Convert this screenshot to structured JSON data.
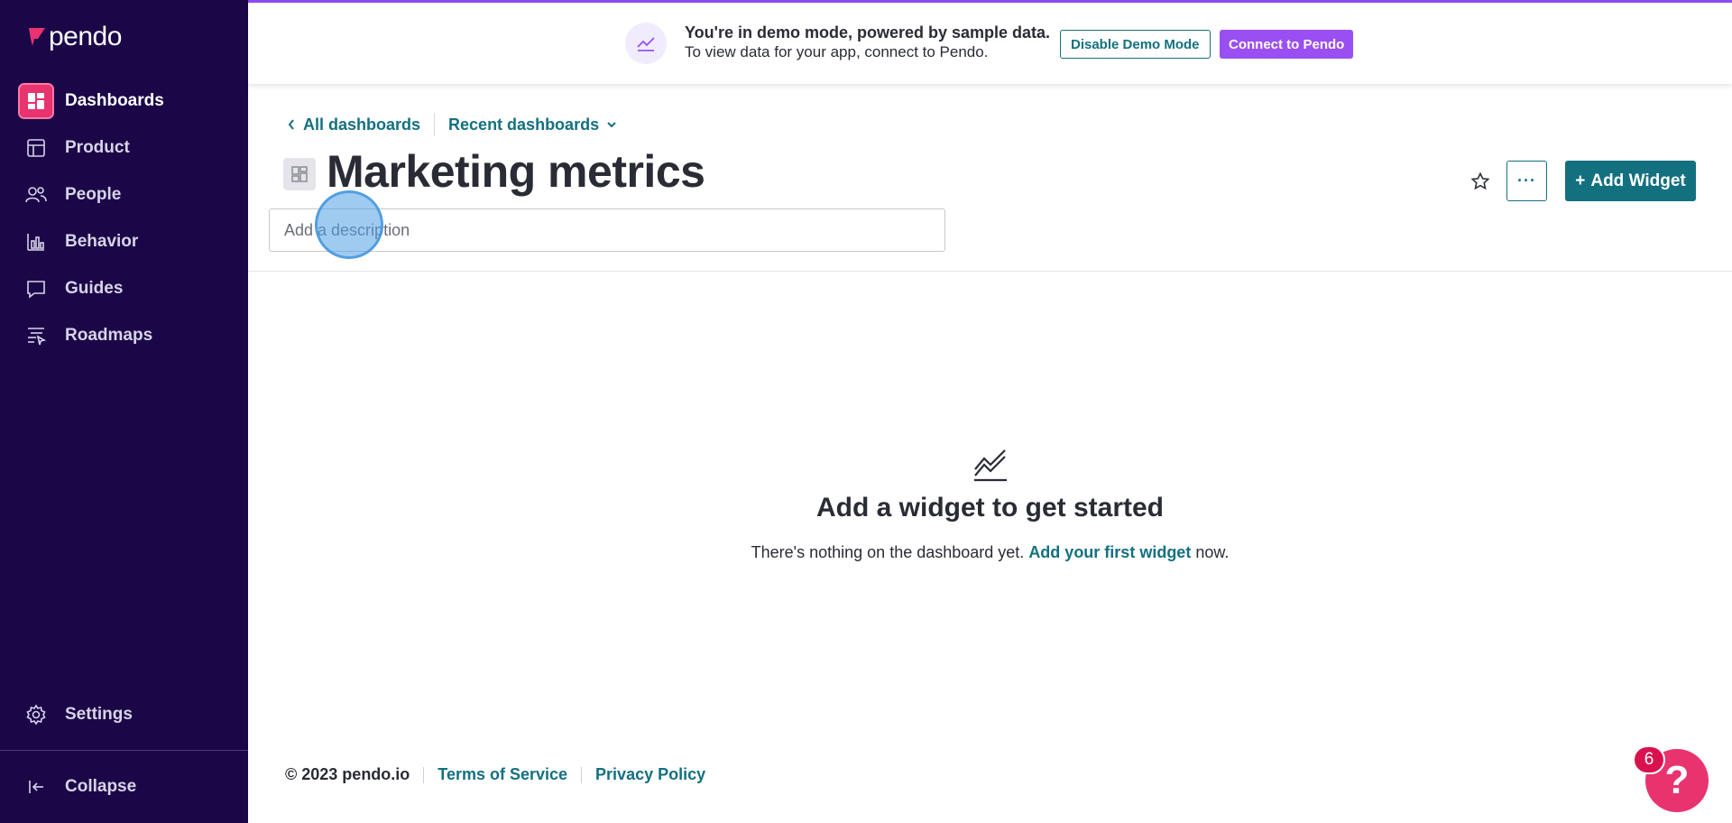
{
  "brand": {
    "name": "pendo",
    "accent": "#e8336f",
    "sidebar_bg": "#1b0748",
    "primary": "#13707f",
    "demo_purple": "#9a4ff2"
  },
  "sidebar": {
    "items": [
      {
        "label": "Dashboards",
        "icon": "dashboard-icon",
        "active": true
      },
      {
        "label": "Product",
        "icon": "layout-icon"
      },
      {
        "label": "People",
        "icon": "people-icon"
      },
      {
        "label": "Behavior",
        "icon": "bar-chart-icon"
      },
      {
        "label": "Guides",
        "icon": "chat-bubble-icon"
      },
      {
        "label": "Roadmaps",
        "icon": "roadmap-icon"
      }
    ],
    "settings_label": "Settings",
    "collapse_label": "Collapse"
  },
  "banner": {
    "title": "You're in demo mode, powered by sample data.",
    "subtitle": "To view data for your app, connect to Pendo.",
    "disable_label": "Disable Demo Mode",
    "connect_label": "Connect to Pendo"
  },
  "header": {
    "breadcrumb_all": "All dashboards",
    "breadcrumb_recent": "Recent dashboards",
    "title": "Marketing metrics",
    "description_placeholder": "Add a description",
    "more_label": "···",
    "add_widget_label": "Add Widget"
  },
  "empty_state": {
    "title": "Add a widget to get started",
    "text_before": "There's nothing on the dashboard yet. ",
    "link": "Add your first widget",
    "text_after": " now."
  },
  "footer": {
    "copyright": "© 2023 pendo.io",
    "terms": "Terms of Service",
    "privacy": "Privacy Policy"
  },
  "help": {
    "badge_count": "6",
    "glyph": "?"
  }
}
